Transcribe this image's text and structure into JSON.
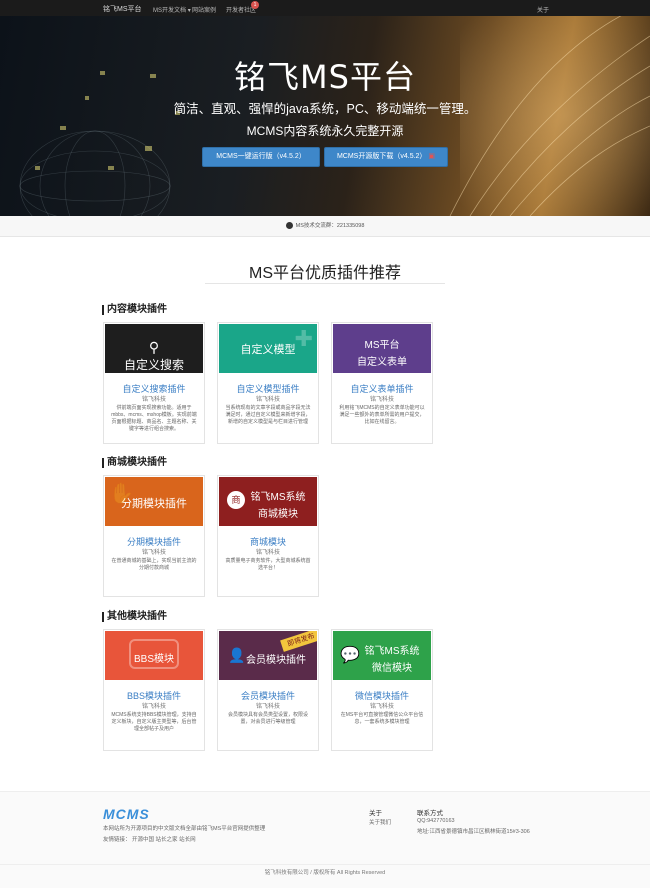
{
  "nav": {
    "brand": "铭飞MS平台",
    "items": [
      "MS开发文档",
      "网站案例",
      "开发者社区"
    ],
    "badge": "1",
    "right": "关于"
  },
  "hero": {
    "title": "铭飞MS平台",
    "subtitle": "简洁、直观、强悍的java系统，PC、移动端统一管理。",
    "subtitle2": "MCMS内容系统永久完整开源",
    "btn1": "MCMS一键运行版（v4.5.2）",
    "btn2": "MCMS开源版下载（v4.5.2）"
  },
  "qq": "MS技术交流群：221335098",
  "section_title": "MS平台优质插件推荐",
  "categories": [
    {
      "title": "内容模块插件",
      "cards": [
        {
          "banner": "自定义搜索",
          "name": "自定义搜索插件",
          "author": "铭飞科技",
          "desc": "供前端页面实现搜索功能。适用于mbbs、mcms、mshop模板。实现前端页面根据标题、商品名、主题名称、关键字等进行组合搜索。",
          "color": "#1e1e1e"
        },
        {
          "banner": "自定义模型",
          "name": "自定义模型插件",
          "author": "铭飞科技",
          "desc": "当系统现有的文章字段或商品字段无法满足时，通过自定义模型来新增字段，新增的自定义模型是与栏目进行管理",
          "color": "#1aa689"
        },
        {
          "banner": "MS平台",
          "banner2": "自定义表单",
          "name": "自定义表单插件",
          "author": "铭飞科技",
          "desc": "利用铭飞MCMS的自定义表单功能可以满足一些额外的表单所需的用户提交，比如在线留言。",
          "color": "#5e3e8c"
        }
      ]
    },
    {
      "title": "商城模块插件",
      "cards": [
        {
          "banner": "分期模块插件",
          "name": "分期模块插件",
          "author": "铭飞科技",
          "desc": "在普通商城的基础上，实现当前主流的分期付款商城",
          "color": "#d9651c"
        },
        {
          "banner": "铭飞MS系统",
          "banner2": "商城模块",
          "name": "商城模块",
          "author": "铭飞科技",
          "desc": "高质量电子商务软件，大型商城系统首选平台！",
          "color": "#8e1f1f"
        }
      ]
    },
    {
      "title": "其他模块插件",
      "cards": [
        {
          "banner": "BBS模块",
          "name": "BBS模块插件",
          "author": "铭飞科技",
          "desc": "MCMS系统支持BBS模块管理，支持自定义板块，自定义版主类型等，后台管理全部帖子及用户",
          "color": "#e8553a"
        },
        {
          "banner": "会员模块插件",
          "ribbon": "即将发布",
          "name": "会员模块插件",
          "author": "铭飞科技",
          "desc": "会员模块具有会员类型设置，权限设置，对会员进行等级管理",
          "color": "#5a2b4a"
        },
        {
          "banner": "铭飞MS系统",
          "banner2": "微信模块",
          "name": "微信模块插件",
          "author": "铭飞科技",
          "desc": "在MS平台可直接管理微信公众平台信息，一套系统多模块管理",
          "color": "#2ea24a"
        }
      ]
    }
  ],
  "footer": {
    "logo": "MCMS",
    "desc": "本网站所为开源项目的中文版文档全部由铭飞MS平台官网提供整理",
    "links": "友情链接：  开源中国   站长之家   站长网",
    "about_h": "关于",
    "about_item": "关于我们",
    "contact_h": "联系方式",
    "qq": "QQ:942770163",
    "addr": "地址:江西省景德镇市昌江区枫林街道15#3-306",
    "copyright": "铭飞科技有限公司  /  版权所有 All Rights Reserved"
  }
}
